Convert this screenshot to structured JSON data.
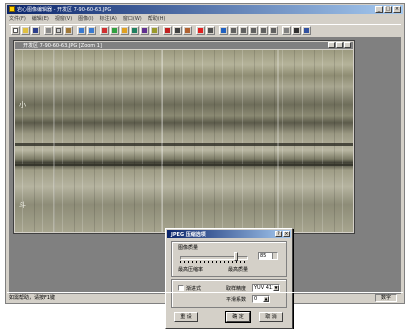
{
  "app": {
    "title": "岩心图像编辑器 - 开发区 7-90-60-63.JPG",
    "menu": [
      "文件(F)",
      "编辑(E)",
      "视窗(V)",
      "图像(I)",
      "标注(A)",
      "窗口(W)",
      "帮助(H)"
    ]
  },
  "child": {
    "title": "开发区 7-90-60-63.JPG [Zoom 1]"
  },
  "status": {
    "text": "如需帮助，请按F1键",
    "pane": "数字"
  },
  "dialog": {
    "title": "JPEG 压缩选项",
    "quality_label": "图像质量",
    "quality_value": "85",
    "min_label": "最高压缩率",
    "max_label": "最高质量",
    "progressive_label": "渐进式",
    "sampling_label": "取样精度",
    "sampling_value": "YUV 411",
    "smooth_label": "平滑系数",
    "smooth_value": "0",
    "reset_button": "重 设",
    "ok_button": "确 定",
    "cancel_button": "取 消",
    "quality_fraction": 0.85
  },
  "core_marks": [
    "小",
    "斗"
  ]
}
